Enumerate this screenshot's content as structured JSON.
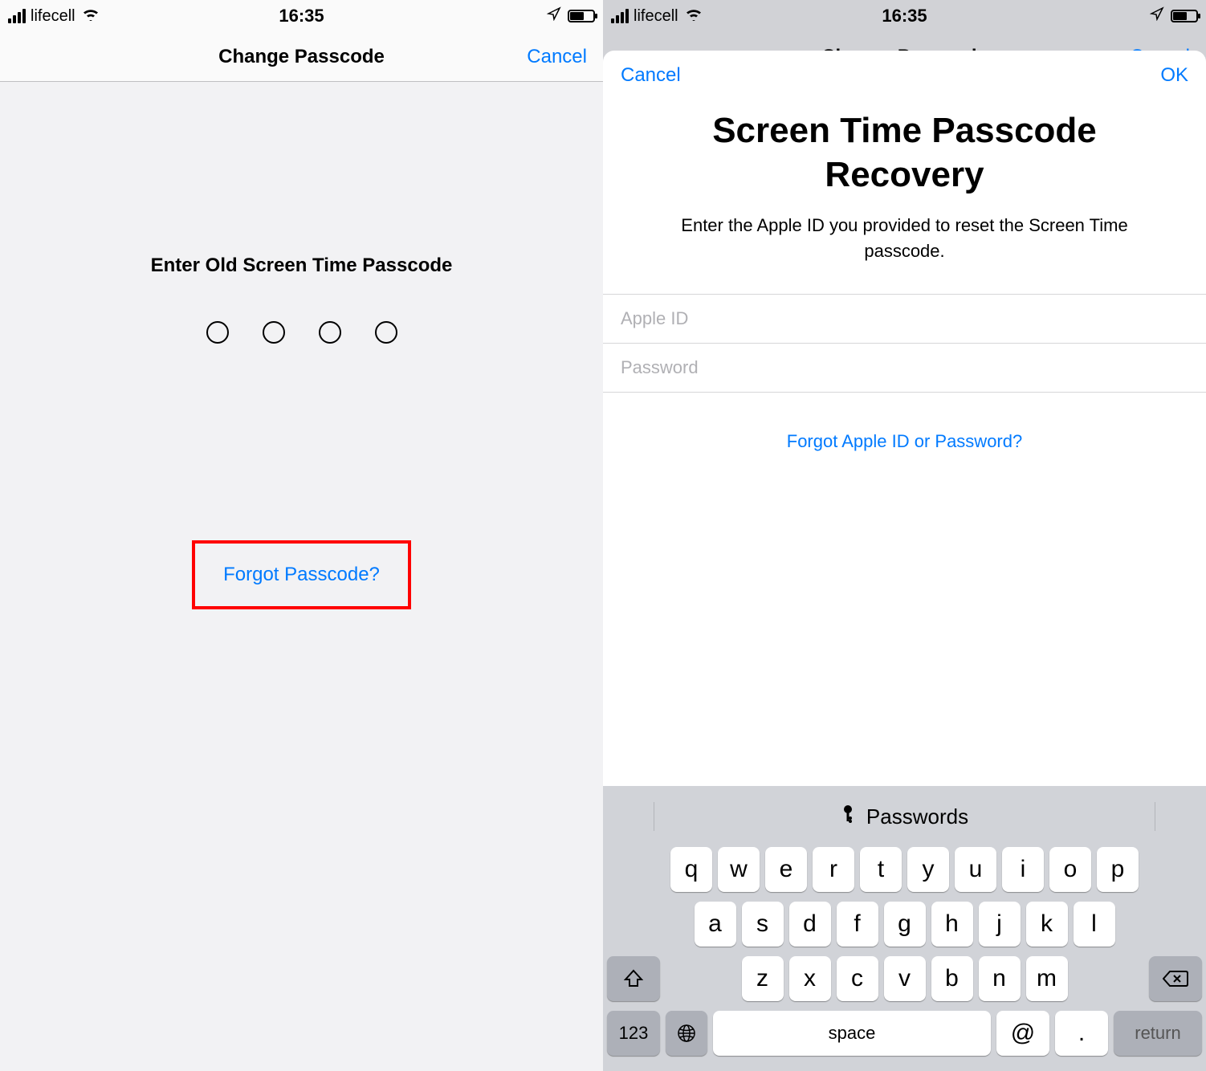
{
  "status": {
    "carrier": "lifecell",
    "time": "16:35"
  },
  "left": {
    "nav_title": "Change Passcode",
    "nav_cancel": "Cancel",
    "prompt": "Enter Old Screen Time Passcode",
    "forgot": "Forgot Passcode?"
  },
  "right": {
    "bg_nav_title": "Change Passcode",
    "bg_nav_cancel": "Cancel",
    "sheet_cancel": "Cancel",
    "sheet_ok": "OK",
    "sheet_title": "Screen Time Passcode Recovery",
    "sheet_desc": "Enter the Apple ID you provided to reset the Screen Time passcode.",
    "apple_id_placeholder": "Apple ID",
    "password_placeholder": "Password",
    "forgot_apple": "Forgot Apple ID or Password?"
  },
  "keyboard": {
    "suggestion": "Passwords",
    "row1": [
      "q",
      "w",
      "e",
      "r",
      "t",
      "y",
      "u",
      "i",
      "o",
      "p"
    ],
    "row2": [
      "a",
      "s",
      "d",
      "f",
      "g",
      "h",
      "j",
      "k",
      "l"
    ],
    "row3": [
      "z",
      "x",
      "c",
      "v",
      "b",
      "n",
      "m"
    ],
    "num_label": "123",
    "space_label": "space",
    "at_label": "@",
    "dot_label": ".",
    "return_label": "return"
  }
}
